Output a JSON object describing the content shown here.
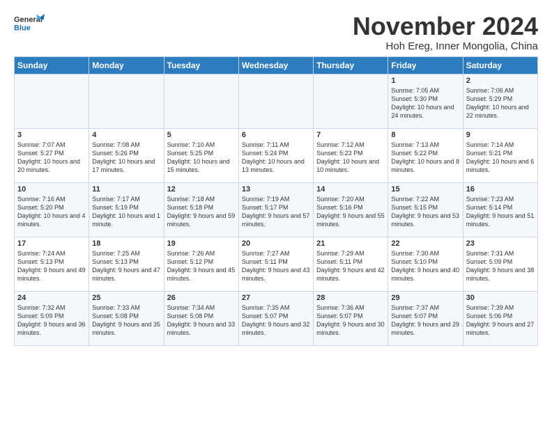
{
  "header": {
    "logo_general": "General",
    "logo_blue": "Blue",
    "month_title": "November 2024",
    "location": "Hoh Ereg, Inner Mongolia, China"
  },
  "days_of_week": [
    "Sunday",
    "Monday",
    "Tuesday",
    "Wednesday",
    "Thursday",
    "Friday",
    "Saturday"
  ],
  "weeks": [
    [
      {
        "num": "",
        "info": ""
      },
      {
        "num": "",
        "info": ""
      },
      {
        "num": "",
        "info": ""
      },
      {
        "num": "",
        "info": ""
      },
      {
        "num": "",
        "info": ""
      },
      {
        "num": "1",
        "info": "Sunrise: 7:05 AM\nSunset: 5:30 PM\nDaylight: 10 hours and 24 minutes."
      },
      {
        "num": "2",
        "info": "Sunrise: 7:06 AM\nSunset: 5:29 PM\nDaylight: 10 hours and 22 minutes."
      }
    ],
    [
      {
        "num": "3",
        "info": "Sunrise: 7:07 AM\nSunset: 5:27 PM\nDaylight: 10 hours and 20 minutes."
      },
      {
        "num": "4",
        "info": "Sunrise: 7:08 AM\nSunset: 5:26 PM\nDaylight: 10 hours and 17 minutes."
      },
      {
        "num": "5",
        "info": "Sunrise: 7:10 AM\nSunset: 5:25 PM\nDaylight: 10 hours and 15 minutes."
      },
      {
        "num": "6",
        "info": "Sunrise: 7:11 AM\nSunset: 5:24 PM\nDaylight: 10 hours and 13 minutes."
      },
      {
        "num": "7",
        "info": "Sunrise: 7:12 AM\nSunset: 5:23 PM\nDaylight: 10 hours and 10 minutes."
      },
      {
        "num": "8",
        "info": "Sunrise: 7:13 AM\nSunset: 5:22 PM\nDaylight: 10 hours and 8 minutes."
      },
      {
        "num": "9",
        "info": "Sunrise: 7:14 AM\nSunset: 5:21 PM\nDaylight: 10 hours and 6 minutes."
      }
    ],
    [
      {
        "num": "10",
        "info": "Sunrise: 7:16 AM\nSunset: 5:20 PM\nDaylight: 10 hours and 4 minutes."
      },
      {
        "num": "11",
        "info": "Sunrise: 7:17 AM\nSunset: 5:19 PM\nDaylight: 10 hours and 1 minute."
      },
      {
        "num": "12",
        "info": "Sunrise: 7:18 AM\nSunset: 5:18 PM\nDaylight: 9 hours and 59 minutes."
      },
      {
        "num": "13",
        "info": "Sunrise: 7:19 AM\nSunset: 5:17 PM\nDaylight: 9 hours and 57 minutes."
      },
      {
        "num": "14",
        "info": "Sunrise: 7:20 AM\nSunset: 5:16 PM\nDaylight: 9 hours and 55 minutes."
      },
      {
        "num": "15",
        "info": "Sunrise: 7:22 AM\nSunset: 5:15 PM\nDaylight: 9 hours and 53 minutes."
      },
      {
        "num": "16",
        "info": "Sunrise: 7:23 AM\nSunset: 5:14 PM\nDaylight: 9 hours and 51 minutes."
      }
    ],
    [
      {
        "num": "17",
        "info": "Sunrise: 7:24 AM\nSunset: 5:13 PM\nDaylight: 9 hours and 49 minutes."
      },
      {
        "num": "18",
        "info": "Sunrise: 7:25 AM\nSunset: 5:13 PM\nDaylight: 9 hours and 47 minutes."
      },
      {
        "num": "19",
        "info": "Sunrise: 7:26 AM\nSunset: 5:12 PM\nDaylight: 9 hours and 45 minutes."
      },
      {
        "num": "20",
        "info": "Sunrise: 7:27 AM\nSunset: 5:11 PM\nDaylight: 9 hours and 43 minutes."
      },
      {
        "num": "21",
        "info": "Sunrise: 7:29 AM\nSunset: 5:11 PM\nDaylight: 9 hours and 42 minutes."
      },
      {
        "num": "22",
        "info": "Sunrise: 7:30 AM\nSunset: 5:10 PM\nDaylight: 9 hours and 40 minutes."
      },
      {
        "num": "23",
        "info": "Sunrise: 7:31 AM\nSunset: 5:09 PM\nDaylight: 9 hours and 38 minutes."
      }
    ],
    [
      {
        "num": "24",
        "info": "Sunrise: 7:32 AM\nSunset: 5:09 PM\nDaylight: 9 hours and 36 minutes."
      },
      {
        "num": "25",
        "info": "Sunrise: 7:33 AM\nSunset: 5:08 PM\nDaylight: 9 hours and 35 minutes."
      },
      {
        "num": "26",
        "info": "Sunrise: 7:34 AM\nSunset: 5:08 PM\nDaylight: 9 hours and 33 minutes."
      },
      {
        "num": "27",
        "info": "Sunrise: 7:35 AM\nSunset: 5:07 PM\nDaylight: 9 hours and 32 minutes."
      },
      {
        "num": "28",
        "info": "Sunrise: 7:36 AM\nSunset: 5:07 PM\nDaylight: 9 hours and 30 minutes."
      },
      {
        "num": "29",
        "info": "Sunrise: 7:37 AM\nSunset: 5:07 PM\nDaylight: 9 hours and 29 minutes."
      },
      {
        "num": "30",
        "info": "Sunrise: 7:39 AM\nSunset: 5:06 PM\nDaylight: 9 hours and 27 minutes."
      }
    ]
  ]
}
